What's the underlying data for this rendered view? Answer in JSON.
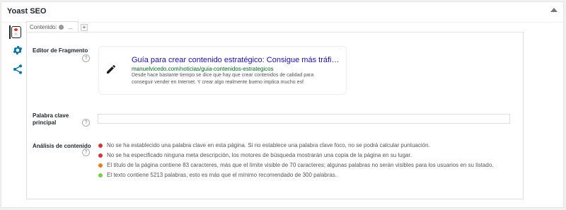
{
  "metabox": {
    "title": "Yoast SEO"
  },
  "tabs": [
    {
      "label": "Contenido:",
      "status_color": "#999999",
      "overflow": "..."
    }
  ],
  "add_tab_label": "+",
  "snippet_editor": {
    "label": "Editor de Fragmento",
    "help": "?",
    "title": "Guía para crear contenido estratégico: Consigue más tráfico, …",
    "url": "manuelvicedo.com/noticias/guia-contenidos-estrategicos",
    "description": "Desde hace bastante tiempo se dice que hay que crear contenidos de calidad para conseguir vender en Internet. Y crear algo realmente bueno implica mucho esf"
  },
  "focus_keyword": {
    "label_line1": "Palabra clave",
    "label_line2": "principal",
    "help": "?",
    "value": ""
  },
  "content_analysis": {
    "label": "Análisis de contenido",
    "help": "?",
    "results": [
      {
        "status": "bad",
        "color": "#dc3232",
        "text": "No se ha establecido una palabra clave en esta página. Si no establece una palabra clave foco, no se podrá calcular puntuación."
      },
      {
        "status": "bad",
        "color": "#dc3232",
        "text": "No se ha especificado ninguna meta descripción, los motores de búsqueda mostrarán una copia de la página en su lugar."
      },
      {
        "status": "ok",
        "color": "#ee7c1b",
        "text": "El título de la página contiene 83 caracteres, más que el límite visible de 70 caracteres; algunas palabras no serán visibles para los usuarios en su listado."
      },
      {
        "status": "good",
        "color": "#7ad03a",
        "text": "El texto contiene 5213 palabras, esto es más que el mínimo recomendado de 300 palabras."
      }
    ]
  },
  "colors": {
    "traffic_light_red": "#dc3232",
    "gear": "#0073aa",
    "share": "#0073aa"
  }
}
